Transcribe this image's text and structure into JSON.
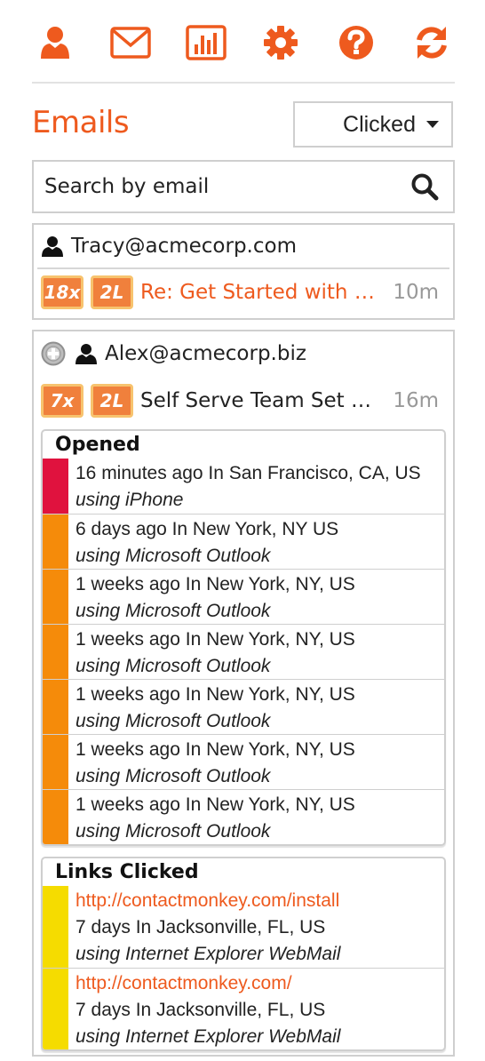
{
  "colors": {
    "accent": "#ee5a1e",
    "badge": "#f0803c",
    "bar_red": "#e0123e",
    "bar_orange": "#f58b0a",
    "bar_yellow": "#f5dc00"
  },
  "toolbar": {
    "icons": [
      "user-icon",
      "mail-icon",
      "bar-chart-icon",
      "gear-icon",
      "help-icon",
      "refresh-icon"
    ]
  },
  "header": {
    "title": "Emails",
    "filter_selected": "Clicked"
  },
  "search": {
    "placeholder": "Search by email"
  },
  "contacts": [
    {
      "email": "Tracy@acmecorp.com",
      "opens_badge": "18x",
      "links_badge": "2L",
      "subject": "Re: Get Started with C...",
      "age": "10m"
    },
    {
      "email": "Alex@acmecorp.biz",
      "opens_badge": "7x",
      "links_badge": "2L",
      "subject": "Self Serve Team Set Up!",
      "age": "16m",
      "opened": {
        "heading": "Opened",
        "rows": [
          {
            "when": "16 minutes ago In San Francisco, CA, US",
            "via": "using iPhone",
            "color": "#e0123e"
          },
          {
            "when": "6 days ago In New York, NY US",
            "via": "using Microsoft Outlook",
            "color": "#f58b0a"
          },
          {
            "when": "1 weeks ago In New York, NY, US",
            "via": "using Microsoft Outlook",
            "color": "#f58b0a"
          },
          {
            "when": "1 weeks ago In New York, NY, US",
            "via": "using Microsoft Outlook",
            "color": "#f58b0a"
          },
          {
            "when": "1 weeks ago In New York, NY, US",
            "via": "using Microsoft Outlook",
            "color": "#f58b0a"
          },
          {
            "when": "1 weeks ago In New York, NY, US",
            "via": "using Microsoft Outlook",
            "color": "#f58b0a"
          },
          {
            "when": "1 weeks ago In New York, NY, US",
            "via": "using Microsoft Outlook",
            "color": "#f58b0a"
          }
        ]
      },
      "links": {
        "heading": "Links Clicked",
        "rows": [
          {
            "url": "http://contactmonkey.com/install",
            "when": "7 days In Jacksonville, FL, US",
            "via": "using Internet Explorer WebMail",
            "color": "#f5dc00"
          },
          {
            "url": "http://contactmonkey.com/",
            "when": "7 days In Jacksonville, FL, US",
            "via": "using Internet Explorer WebMail",
            "color": "#f5dc00"
          }
        ]
      }
    }
  ]
}
